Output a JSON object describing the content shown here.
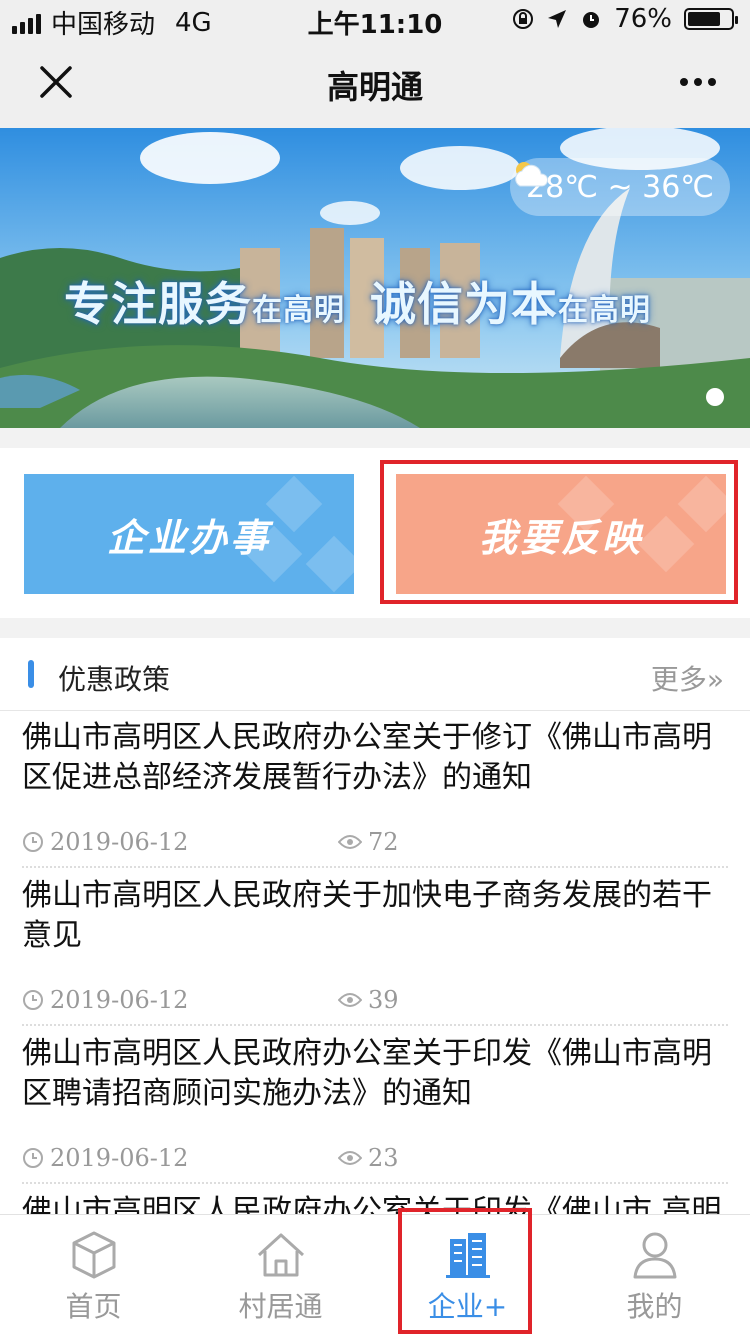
{
  "status_bar": {
    "carrier": "中国移动",
    "network": "4G",
    "time": "上午11:10",
    "battery": "76%",
    "battery_level": 0.76
  },
  "nav": {
    "title": "高明通"
  },
  "banner": {
    "weather": "28℃ ~ 36℃",
    "slogan_1": "专注服务",
    "slogan_1_suffix": "在高明",
    "slogan_2": "诚信为本",
    "slogan_2_suffix": "在高明"
  },
  "actions": {
    "enterprise": "企业办事",
    "feedback": "我要反映"
  },
  "section": {
    "title": "优惠政策",
    "more": "更多»"
  },
  "articles": [
    {
      "title": "佛山市高明区人民政府办公室关于修订《佛山市高明区促进总部经济发展暂行办法》的通知",
      "date": "2019-06-12",
      "views": "72"
    },
    {
      "title": "佛山市高明区人民政府关于加快电子商务发展的若干意见",
      "date": "2019-06-12",
      "views": "39"
    },
    {
      "title": "佛山市高明区人民政府办公室关于印发《佛山市高明区聘请招商顾问实施办法》的通知",
      "date": "2019-06-12",
      "views": "23"
    },
    {
      "title": "佛山市高明区人民政府办公室关于印发《佛山市 高明",
      "date": "",
      "views": ""
    }
  ],
  "tabs": [
    {
      "label": "首页",
      "icon": "cube-icon"
    },
    {
      "label": "村居通",
      "icon": "house-icon"
    },
    {
      "label": "企业+",
      "icon": "building-icon"
    },
    {
      "label": "我的",
      "icon": "person-icon"
    }
  ],
  "colors": {
    "accent": "#3a8ee6",
    "highlight": "#e0242a",
    "enterprise_btn": "#5eb0ec",
    "feedback_btn": "#f7a589"
  }
}
